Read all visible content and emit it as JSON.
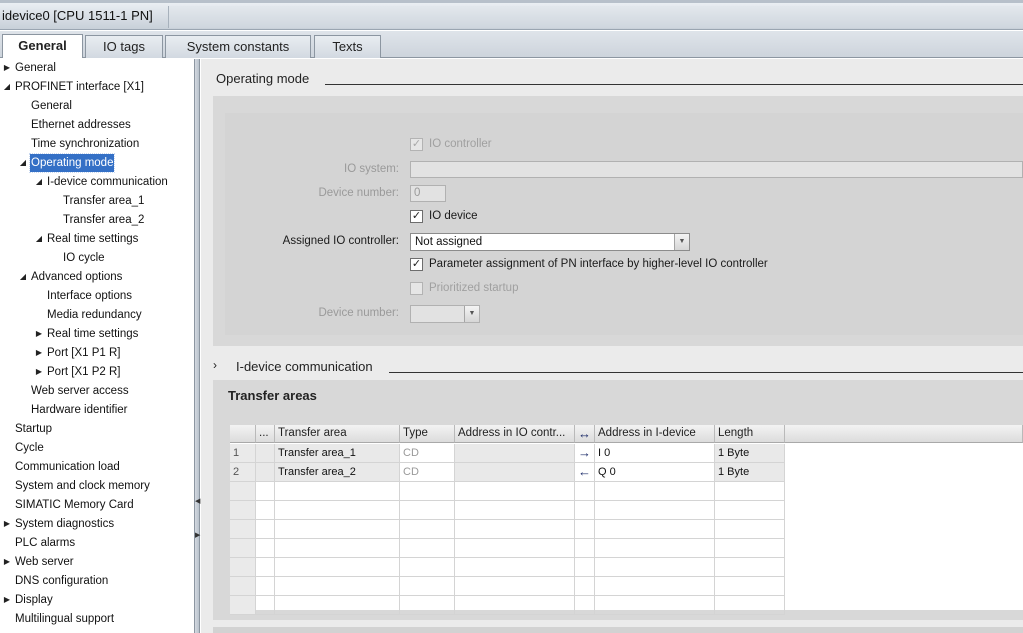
{
  "window": {
    "title": "idevice0 [CPU 1511-1 PN]"
  },
  "tabs": [
    {
      "label": "General",
      "active": true
    },
    {
      "label": "IO tags",
      "active": false
    },
    {
      "label": "System constants",
      "active": false
    },
    {
      "label": "Texts",
      "active": false
    }
  ],
  "tree": [
    {
      "label": "General",
      "arrow": "collapsed"
    },
    {
      "label": "PROFINET interface [X1]",
      "arrow": "expanded"
    },
    {
      "label": "General",
      "arrow": "none"
    },
    {
      "label": "Ethernet addresses",
      "arrow": "none"
    },
    {
      "label": "Time synchronization",
      "arrow": "none"
    },
    {
      "label": "Operating mode",
      "arrow": "expanded",
      "selected": true
    },
    {
      "label": "I-device communication",
      "arrow": "expanded"
    },
    {
      "label": "Transfer area_1",
      "arrow": "none"
    },
    {
      "label": "Transfer area_2",
      "arrow": "none"
    },
    {
      "label": "Real time settings",
      "arrow": "expanded"
    },
    {
      "label": "IO cycle",
      "arrow": "none"
    },
    {
      "label": "Advanced options",
      "arrow": "expanded"
    },
    {
      "label": "Interface options",
      "arrow": "none"
    },
    {
      "label": "Media redundancy",
      "arrow": "none"
    },
    {
      "label": "Real time settings",
      "arrow": "collapsed"
    },
    {
      "label": "Port [X1 P1 R]",
      "arrow": "collapsed"
    },
    {
      "label": "Port [X1 P2 R]",
      "arrow": "collapsed"
    },
    {
      "label": "Web server access",
      "arrow": "none"
    },
    {
      "label": "Hardware identifier",
      "arrow": "none"
    },
    {
      "label": "Startup",
      "arrow": "none"
    },
    {
      "label": "Cycle",
      "arrow": "none"
    },
    {
      "label": "Communication load",
      "arrow": "none"
    },
    {
      "label": "System and clock memory",
      "arrow": "none"
    },
    {
      "label": "SIMATIC Memory Card",
      "arrow": "none"
    },
    {
      "label": "System diagnostics",
      "arrow": "collapsed"
    },
    {
      "label": "PLC alarms",
      "arrow": "none"
    },
    {
      "label": "Web server",
      "arrow": "collapsed"
    },
    {
      "label": "DNS configuration",
      "arrow": "none"
    },
    {
      "label": "Display",
      "arrow": "collapsed"
    },
    {
      "label": "Multilingual support",
      "arrow": "none"
    }
  ],
  "operating_mode": {
    "section_title": "Operating mode",
    "io_controller_label": "IO controller",
    "io_controller_checked": true,
    "io_system_label": "IO system:",
    "io_system_value": "",
    "device_number_label": "Device number:",
    "device_number_value": "0",
    "io_device_label": "IO device",
    "io_device_checked": true,
    "assigned_controller_label": "Assigned IO controller:",
    "assigned_controller_value": "Not assigned",
    "param_assign_label": "Parameter assignment of PN interface by higher-level IO controller",
    "param_assign_checked": true,
    "prioritized_startup_label": "Prioritized startup",
    "prioritized_startup_checked": false,
    "device_number2_label": "Device number:",
    "device_number2_value": ""
  },
  "idevice": {
    "section_title": "I-device communication",
    "expander": "›",
    "transfer_areas_title": "Transfer areas",
    "columns": [
      "...",
      "Transfer area",
      "Type",
      "Address in IO contr...",
      "↔",
      "Address in I-device",
      "Length"
    ],
    "rows": [
      {
        "num": "1",
        "name": "Transfer area_1",
        "type": "CD",
        "addr_ctrl": "",
        "dir": "→",
        "addr_dev": "I 0",
        "length": "1 Byte"
      },
      {
        "num": "2",
        "name": "Transfer area_2",
        "type": "CD",
        "addr_ctrl": "",
        "dir": "←",
        "addr_dev": "Q 0",
        "length": "1 Byte"
      }
    ]
  }
}
